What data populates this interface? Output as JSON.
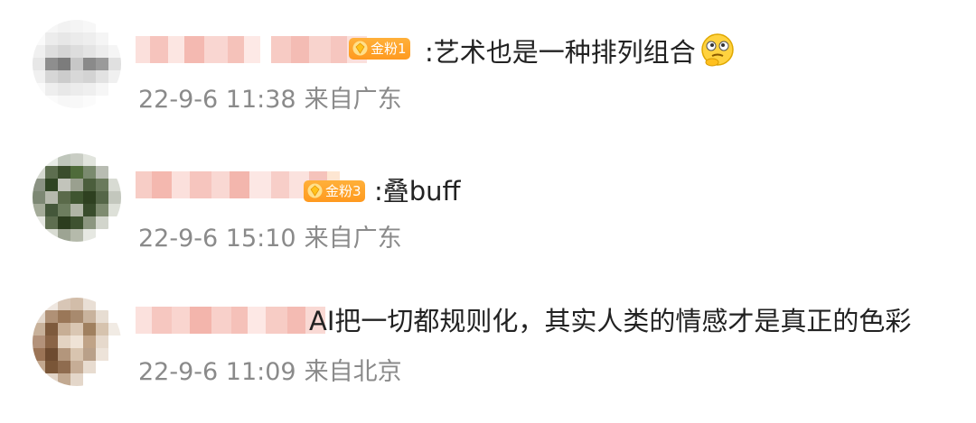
{
  "comments": [
    {
      "badge": "金粉1",
      "text": ":艺术也是一种排列组合",
      "emoji_icon": "thinking-face-icon",
      "timestamp": "22-9-6 11:38",
      "location": "来自广东"
    },
    {
      "badge": "金粉3",
      "text": ":叠buff",
      "timestamp": "22-9-6 15:10",
      "location": "来自广东"
    },
    {
      "text": "AI把一切都规则化，其实人类的情感才是真正的色彩",
      "timestamp": "22-9-6 11:09",
      "location": "来自北京"
    }
  ],
  "colors": {
    "badge": "#ff9f26",
    "meta_text": "#8a8a8a",
    "body_text": "#222222",
    "name_blur": "#f6c9c2"
  }
}
